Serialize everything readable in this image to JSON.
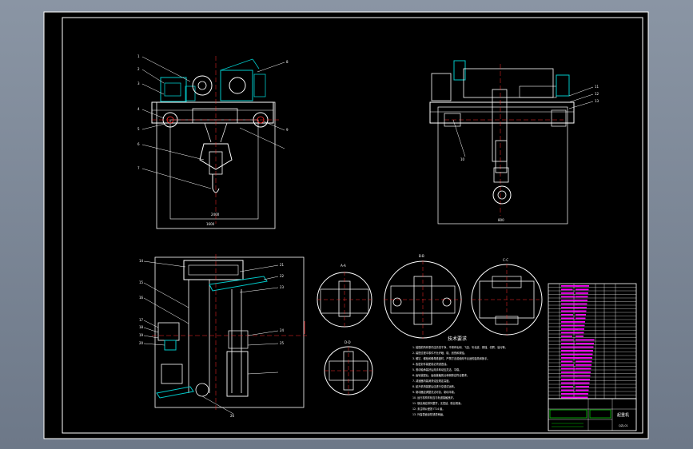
{
  "drawing": {
    "title_block_title": "起重机",
    "title_block_code": "QZJ-01",
    "tech_requirements_title": "技术要求",
    "tech_requirements_lines": [
      "1. 装配前所有零件应清洗干净，不得有毛刺、飞边、氧化皮、锈蚀、切屑、油污等。",
      "2. 装配过程中零件不允许磕、碰、划伤和锈蚀。",
      "3. 螺钉、螺栓和螺母紧固时，严禁打击或使用不合适的旋具和扳手。",
      "4. 各密封件装配前必须浸透油。",
      "5. 滚动轴承装好后用手转动应灵活、平稳。",
      "6. 齿轮装配后，齿面接触斑点和侧隙应符合要求。",
      "7. 减速器内装润滑油至规定高度。",
      "8. 起升机构装配后应进行空载试运转。",
      "9. 制动器应调整灵活可靠，制动平稳。",
      "10. 运行机构车轮应与轨道接触良好。",
      "11. 钢丝绳应排列整齐，无扭结、断丝现象。",
      "12. 未注明公差按 IT14 级。",
      "13. 外露表面涂防锈漆两遍。"
    ],
    "dims": {
      "front_width": "1600",
      "side_width": "800",
      "front_height": "2400"
    },
    "section_labels": [
      "A-A",
      "B-B",
      "C-C",
      "D-D"
    ],
    "part_callouts_front": [
      "1",
      "2",
      "3",
      "4",
      "5",
      "6",
      "7",
      "8",
      "9"
    ],
    "part_callouts_side": [
      "10",
      "11",
      "12",
      "13"
    ],
    "part_callouts_plan": [
      "14",
      "15",
      "16",
      "17",
      "18",
      "19",
      "20",
      "21",
      "22",
      "23",
      "24",
      "25",
      "26"
    ],
    "colors": {
      "background": "#000000",
      "border": "#ffffff",
      "cyan": "#00c8c8",
      "red": "#ff2a2a",
      "magenta": "#ff00ff",
      "green": "#00c800",
      "gray": "#a0a0a0"
    }
  }
}
